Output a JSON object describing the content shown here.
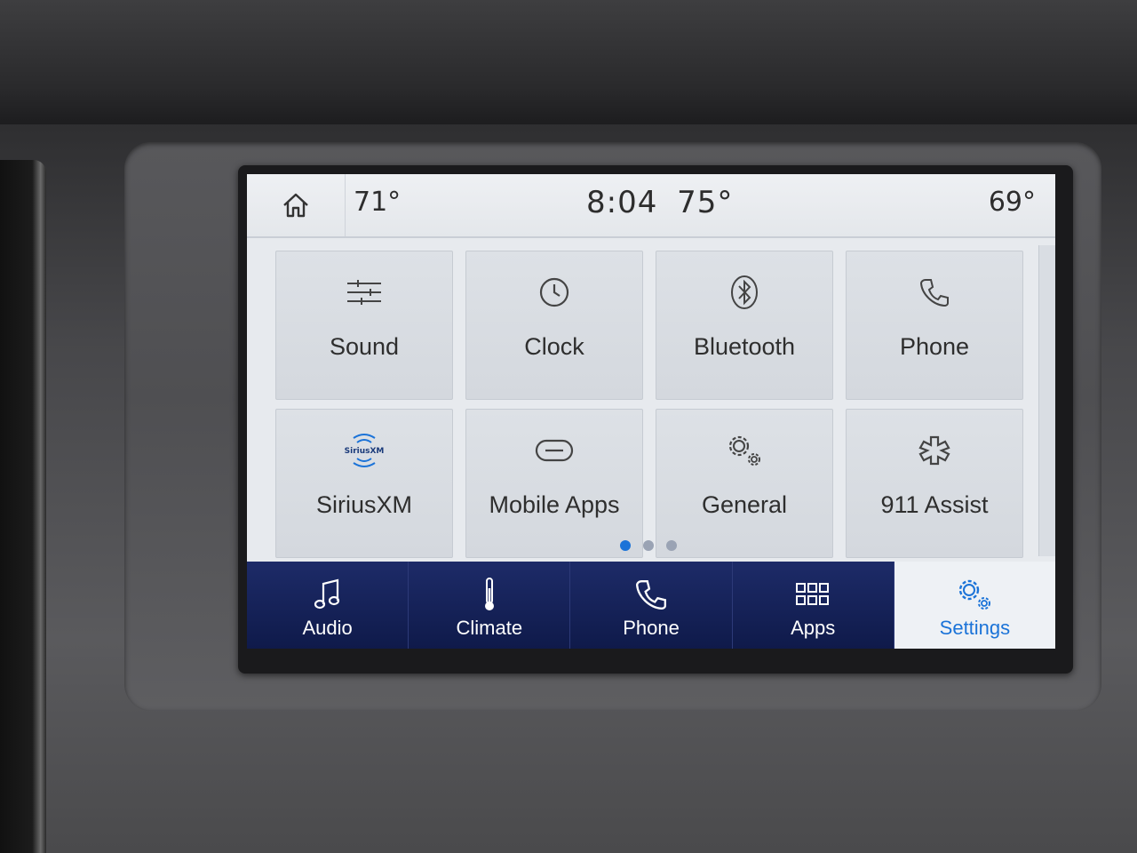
{
  "status": {
    "left_temp": "71°",
    "time": "8:04",
    "outside_temp": "75°",
    "right_temp": "69°"
  },
  "tiles": [
    {
      "label": "Sound",
      "icon": "sliders-icon"
    },
    {
      "label": "Clock",
      "icon": "clock-icon"
    },
    {
      "label": "Bluetooth",
      "icon": "bluetooth-icon"
    },
    {
      "label": "Phone",
      "icon": "phone-icon"
    },
    {
      "label": "SiriusXM",
      "icon": "siriusxm-icon"
    },
    {
      "label": "Mobile Apps",
      "icon": "link-icon"
    },
    {
      "label": "General",
      "icon": "gears-icon"
    },
    {
      "label": "911 Assist",
      "icon": "asterisk-icon"
    }
  ],
  "siriusxm_logo_text": "SiriusXM",
  "pagination": {
    "pages": 3,
    "current": 1
  },
  "nav": [
    {
      "label": "Audio",
      "icon": "music-note-icon"
    },
    {
      "label": "Climate",
      "icon": "thermometer-icon"
    },
    {
      "label": "Phone",
      "icon": "phone-icon"
    },
    {
      "label": "Apps",
      "icon": "apps-grid-icon"
    },
    {
      "label": "Settings",
      "icon": "gears-icon",
      "active": true
    }
  ],
  "colors": {
    "accent": "#1b73d8",
    "nav_bg": "#1d2b68"
  }
}
